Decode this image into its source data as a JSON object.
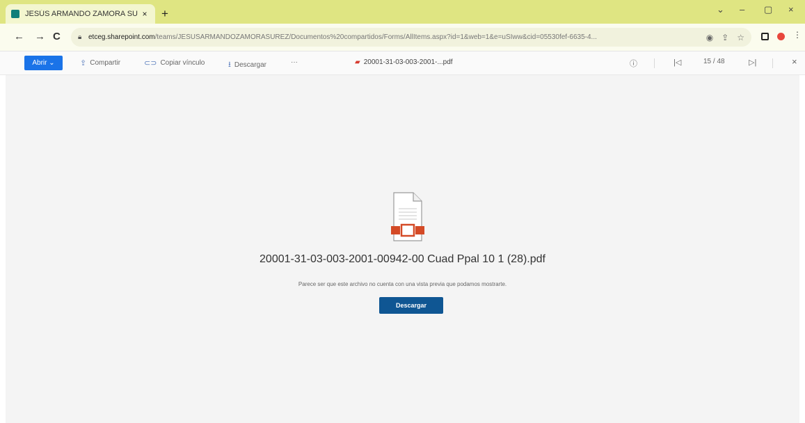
{
  "browser": {
    "tab_title": "JESÚS ARMANDO ZAMORA SU",
    "tab_close": "×",
    "new_tab": "+",
    "url_host": "etceg.sharepoint.com",
    "url_path": "/teams/JESUSARMANDOZAMORASUREZ/Documentos%20compartidos/Forms/AllItems.aspx?id=1&web=1&e=uSIww&cid=05530fef-6635-4...",
    "window_controls": [
      "⌄",
      "–",
      "▢",
      "×"
    ],
    "nav": {
      "back": "←",
      "forward": "→",
      "reload": "C"
    }
  },
  "toolbar": {
    "open_label": "Abrir ⌄",
    "share_label": "Compartir",
    "copy_link_label": "Copiar vínculo",
    "download_label": "Descargar",
    "more_label": "···",
    "file_name": "20001-31-03-003-2001-...pdf",
    "page_indicator": "15 / 48",
    "info": "ⓘ",
    "prev": "|◁",
    "next": "▷|",
    "close": "×"
  },
  "content": {
    "file_title": "20001-31-03-003-2001-00942-00 Cuad Ppal 10 1 (28).pdf",
    "message": "Parece ser que este archivo no cuenta con una vista previa que podamos mostrarte.",
    "download_button": "Descargar"
  },
  "colors": {
    "tabstrip": "#dfe582",
    "primary_button": "#1a73e8",
    "download_button": "#0f5693",
    "pdf_accent": "#d63b2f"
  }
}
